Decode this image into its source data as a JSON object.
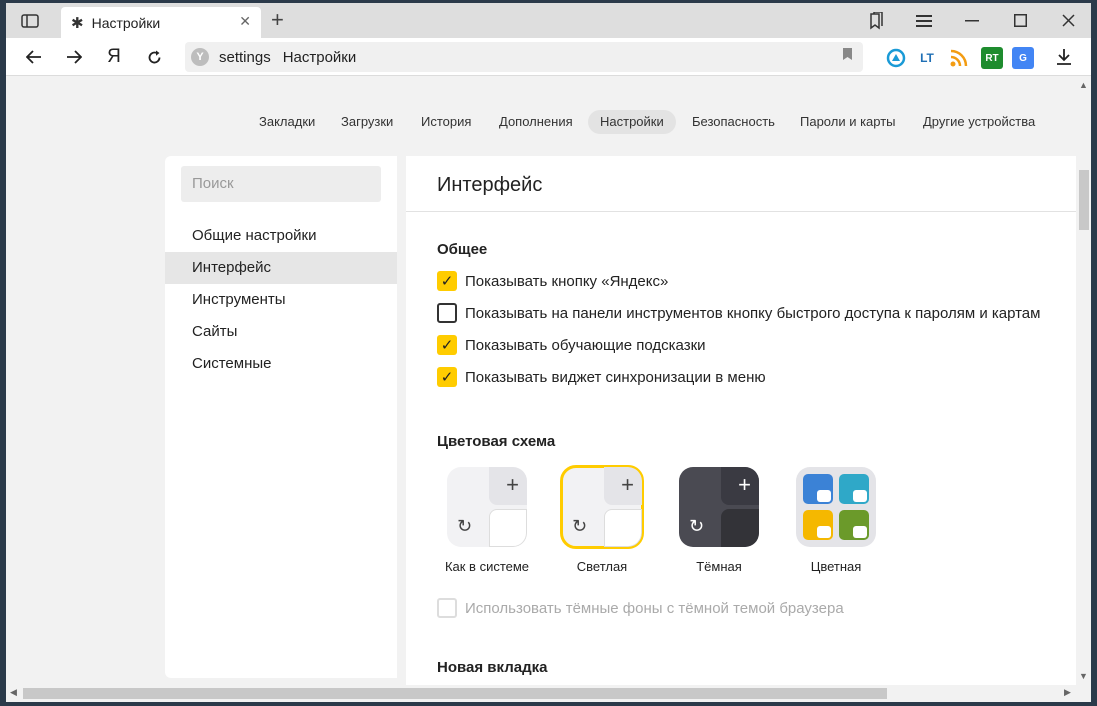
{
  "tab": {
    "title": "Настройки"
  },
  "address": {
    "url": "settings",
    "title": "Настройки",
    "shield": "Y"
  },
  "toolbar": {
    "yandex": "Я"
  },
  "extensions": [
    {
      "name": "air-icon",
      "label": "◬",
      "color": "#1a9ad6"
    },
    {
      "name": "lt-icon",
      "label": "LT",
      "color": "#1f6fb5"
    },
    {
      "name": "rss-icon",
      "label": "◉",
      "color": "#f39c12"
    },
    {
      "name": "rt-icon",
      "label": "RT",
      "color": "#1e8c2e"
    },
    {
      "name": "translate-icon",
      "label": "G",
      "color": "#4285f4"
    }
  ],
  "nav": {
    "links": [
      "Закладки",
      "Загрузки",
      "История",
      "Дополнения",
      "Настройки",
      "Безопасность",
      "Пароли и карты",
      "Другие устройства"
    ]
  },
  "sidebar": {
    "search_placeholder": "Поиск",
    "items": [
      "Общие настройки",
      "Интерфейс",
      "Инструменты",
      "Сайты",
      "Системные"
    ]
  },
  "main": {
    "title": "Интерфейс",
    "general": {
      "title": "Общее",
      "options": [
        {
          "label": "Показывать кнопку «Яндекс»",
          "checked": true
        },
        {
          "label": "Показывать на панели инструментов кнопку быстрого доступа к паролям и картам",
          "checked": false
        },
        {
          "label": "Показывать обучающие подсказки",
          "checked": true
        },
        {
          "label": "Показывать виджет синхронизации в меню",
          "checked": true
        }
      ]
    },
    "color_scheme": {
      "title": "Цветовая схема",
      "themes": [
        "Как в системе",
        "Светлая",
        "Тёмная",
        "Цветная"
      ],
      "selected": "Светлая",
      "dark_bg_option": "Использовать тёмные фоны с тёмной темой браузера"
    },
    "new_tab": {
      "title": "Новая вкладка"
    }
  },
  "colors": {
    "accent": "#ffcc00"
  }
}
